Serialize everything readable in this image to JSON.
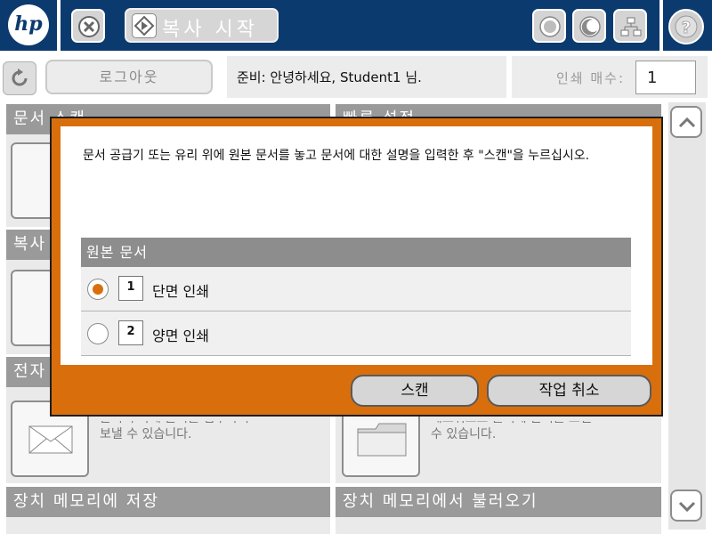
{
  "topbar": {
    "logo_text": "hp",
    "start_copy_label": "복사 시작",
    "icons": [
      "stop-icon",
      "start-icon",
      "globe-icon",
      "sleep-icon",
      "network-icon",
      "help-icon"
    ]
  },
  "row2": {
    "logout_label": "로그아웃",
    "status_text": "준비: 안녕하세요, Student1 님.",
    "copies_label": "인쇄 매수:",
    "copies_value": "1"
  },
  "home_tiles": {
    "scan_doc": {
      "title": "문서 스캔"
    },
    "quick_set": {
      "title": "빠른 설정"
    },
    "copy": {
      "title": "복사"
    },
    "email": {
      "title": "전자"
    },
    "email_desc": "문서 부착에 문서를 첨부하여\n보낼 수 있습니다.",
    "network_desc": "네트워크로 폴더에 문서를 보낼\n수 있습니다.",
    "save_memory": {
      "title": "장치 메모리에 저장"
    },
    "load_memory": {
      "title": "장치 메모리에서 불러오기"
    }
  },
  "dialog": {
    "message": "문서 공급기 또는 유리 위에 원본 문서를 놓고 문서에 대한 설명을 입력한 후 \"스캔\"을 누르십시오.",
    "options_header": "원본 문서",
    "options": [
      {
        "page_number": "1",
        "label": "단면 인쇄",
        "selected": true
      },
      {
        "page_number": "2",
        "label": "양면 인쇄",
        "selected": false
      }
    ],
    "scan_button": "스캔",
    "cancel_button": "작업 취소"
  },
  "colors": {
    "header_blue": "#0b3a6e",
    "dialog_orange": "#d96f0c"
  }
}
